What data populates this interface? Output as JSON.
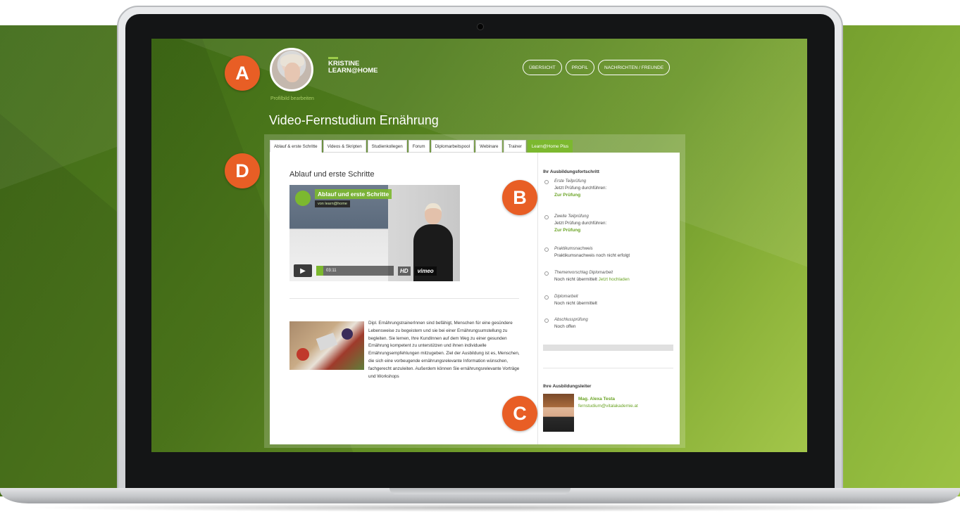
{
  "colors": {
    "accent_green": "#7cb82f",
    "link_green": "#6aa324",
    "marker_orange": "#e85e25"
  },
  "header": {
    "avatar_alt": "Kristine Profilbild",
    "edit_profile": "Profilbild bearbeiten",
    "brand_line1": "KRISTINE",
    "brand_line2": "LEARN@HOME",
    "nav": [
      "ÜBERSICHT",
      "PROFIL",
      "NACHRICHTEN / FREUNDE"
    ]
  },
  "page_title": "Video-Fernstudium Ernährung",
  "tabs": [
    "Ablauf & erste Schritte",
    "Videos & Skripten",
    "Studienkollegen",
    "Forum",
    "Diplomarbeitspool",
    "Webinare",
    "Trainer",
    "Learn@Home Plus"
  ],
  "main": {
    "heading": "Ablauf und erste Schritte",
    "video": {
      "title": "Ablauf und erste Schritte",
      "subtitle": "von learn@home",
      "time": "03:11",
      "hd": "HD",
      "vimeo": "vimeo",
      "play_icon": "play-icon"
    },
    "description": "Dipl. ErnährungstrainerInnen sind befähigt, Menschen für eine gesündere Lebensweise zu begeistern und sie bei einer Ernährungsumstellung zu begleiten. Sie lernen, Ihre KundInnen auf dem Weg zu einer gesunden Ernährung kompetent zu unterstützen und ihnen individuelle Ernährungsempfehlungen mitzugeben. Ziel der Ausbildung ist es, Menschen, die sich eine vorbeugende ernährungsrelevante Information wünschen, fachgerecht anzuleiten. Außerdem können Sie ernährungsrelevante Vorträge und Workshops"
  },
  "sidebar": {
    "progress_heading": "Ihr Ausbildungsfortschritt",
    "steps": [
      {
        "title": "Erste Teilprüfung",
        "status": "Jetzt Prüfung durchführen:",
        "link": "Zur Prüfung"
      },
      {
        "title": "Zweite Teilprüfung",
        "status": "Jetzt Prüfung durchführen:",
        "link": "Zur Prüfung"
      },
      {
        "title": "Praktikumsnachweis",
        "status": "Praktikumsnachweis noch nicht erfolgt"
      },
      {
        "title": "Themenvorschlag Diplomarbeit",
        "status": "Noch nicht übermittelt",
        "inline_link": "Jetzt hochladen"
      },
      {
        "title": "Diplomarbeit",
        "status": "Noch nicht übermittelt"
      },
      {
        "title": "Abschlussprüfung",
        "status": "Noch offen"
      }
    ],
    "progress_value": 0,
    "trainer_heading": "Ihre Ausbildungsleiter",
    "trainer_name": "Mag. Alexa Testa",
    "trainer_email": "fernstudium@vitalakademie.at"
  },
  "markers": [
    "A",
    "B",
    "C",
    "D"
  ]
}
